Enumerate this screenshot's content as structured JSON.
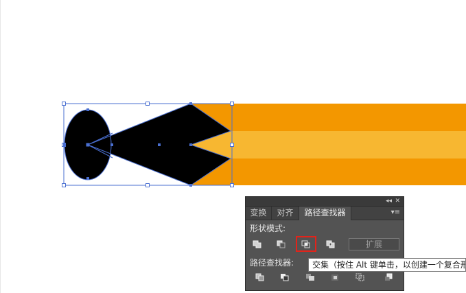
{
  "canvas": {
    "colors": {
      "stripe_orange": "#f39700",
      "stripe_light": "#f7b731",
      "shape_fill": "#000000",
      "selection": "#4a6fd1",
      "background": "#ffffff"
    }
  },
  "panel": {
    "collapse_icon": "double-chevron-right",
    "close_icon": "x",
    "tabs": [
      {
        "label": "变换",
        "active": false
      },
      {
        "label": "对齐",
        "active": false
      },
      {
        "label": "路径查找器",
        "active": true
      }
    ],
    "menu_icon": "panel-menu",
    "shape_modes_label": "形状模式:",
    "shape_mode_buttons": [
      "unite-icon",
      "minus-front-icon",
      "intersect-icon",
      "exclude-icon"
    ],
    "expand_label": "扩展",
    "pathfinders_label": "路径查找器:",
    "pathfinder_buttons": [
      "divide-icon",
      "trim-icon",
      "merge-icon",
      "crop-icon",
      "outline-icon",
      "minus-back-icon"
    ]
  },
  "tooltip": {
    "text": "交集（按住 Alt 键单击，以创建一个复合形"
  }
}
